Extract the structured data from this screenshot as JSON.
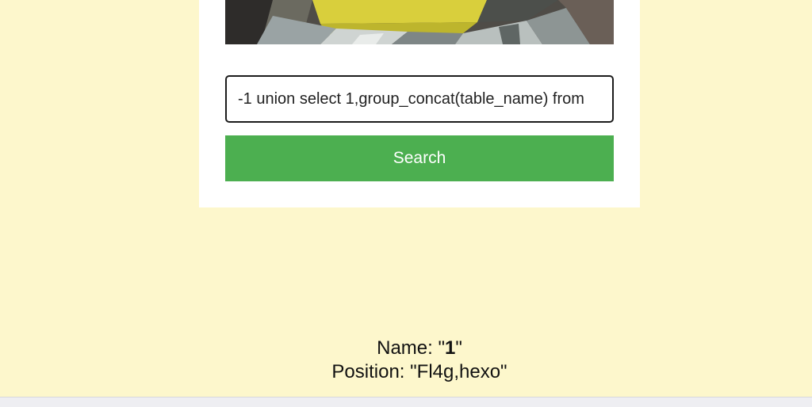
{
  "colors": {
    "page_background": "#fdf7cc",
    "card_background": "#ffffff",
    "button_background": "#4caf50",
    "button_text": "#ffffff"
  },
  "search": {
    "value": "-1 union select 1,group_concat(table_name) from",
    "button_label": "Search"
  },
  "result": {
    "name_prefix": "Name: \"",
    "name_value": "1",
    "name_suffix": "\"",
    "position_text": "Position: \"Fl4g,hexo\""
  }
}
